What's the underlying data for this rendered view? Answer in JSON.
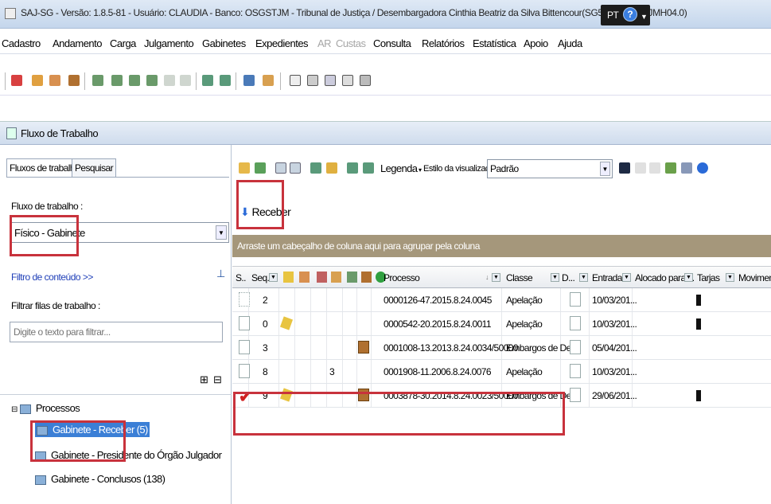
{
  "window": {
    "title": "SAJ-SG - Versão: 1.8.5-81 - Usuário: CLAUDIA - Banco: OSGSTJM - Tribunal de Justiça / Desembargadora Cinthia Beatriz da Silva Bittencour(SG5.APPSGSTJMH04.0)",
    "lang": "PT"
  },
  "menu": [
    {
      "label": "Cadastro",
      "enabled": true
    },
    {
      "label": "Andamento",
      "enabled": true
    },
    {
      "label": "Carga",
      "enabled": true
    },
    {
      "label": "Julgamento",
      "enabled": true
    },
    {
      "label": "Gabinetes",
      "enabled": true
    },
    {
      "label": "Expedientes",
      "enabled": true
    },
    {
      "label": "AR",
      "enabled": false
    },
    {
      "label": "Custas",
      "enabled": false
    },
    {
      "label": "Consulta",
      "enabled": true
    },
    {
      "label": "Relatórios",
      "enabled": true
    },
    {
      "label": "Estatística",
      "enabled": true
    },
    {
      "label": "Apoio",
      "enabled": true
    },
    {
      "label": "Ajuda",
      "enabled": true
    }
  ],
  "panel_title": "Fluxo de Trabalho",
  "left": {
    "tabs": [
      "Fluxos de trabalho",
      "Pesquisar"
    ],
    "fluxo_label": "Fluxo de trabalho :",
    "fluxo_value": "Físico - Gabinete",
    "filtro_conteudo": "Filtro de conteúdo >>",
    "filtrar_label": "Filtrar filas de trabalho :",
    "filtrar_placeholder": "Digite o texto para filtrar...",
    "tree": {
      "root": "Processos",
      "items": [
        "Gabinete - Receber (5)",
        "Gabinete - Presidente do Órgão Julgador",
        "Gabinete - Conclusos (138)"
      ]
    }
  },
  "right": {
    "legenda": "Legenda",
    "estilo_label": "Estilo da visualização :",
    "estilo_value": "Padrão",
    "receber": "Receber",
    "groupbar": "Arraste um cabeçalho de coluna aqui para agrupar pela coluna",
    "columns": [
      "S..",
      "Seq.",
      "Processo",
      "Classe",
      "D...",
      "Entrada",
      "Alocado para ...",
      "Tarjas",
      "Movimento"
    ],
    "rows": [
      {
        "seq": "2",
        "col3": "",
        "processo": "0000126-47.2015.8.24.0045",
        "classe": "Apelação",
        "entrada": "10/03/201...",
        "tarja": true,
        "checked": false
      },
      {
        "seq": "0",
        "col3": "",
        "processo": "0000542-20.2015.8.24.0011",
        "classe": "Apelação",
        "entrada": "10/03/201...",
        "tarja": true,
        "checked": false
      },
      {
        "seq": "3",
        "col3": "",
        "processo": "0001008-13.2013.8.24.0034/50000",
        "classe": "Embargos de De...",
        "entrada": "05/04/201...",
        "tarja": false,
        "checked": false
      },
      {
        "seq": "8",
        "col3": "3",
        "processo": "0001908-11.2006.8.24.0076",
        "classe": "Apelação",
        "entrada": "10/03/201...",
        "tarja": false,
        "checked": false
      },
      {
        "seq": "9",
        "col3": "",
        "processo": "0003878-30.2014.8.24.0023/50000",
        "classe": "Embargos de De...",
        "entrada": "29/06/201...",
        "tarja": true,
        "checked": true
      }
    ]
  },
  "colors": {
    "highlight_box": "#c8323c",
    "selected_item": "#3b7fd6",
    "groupbar_bg": "#a5977b"
  }
}
